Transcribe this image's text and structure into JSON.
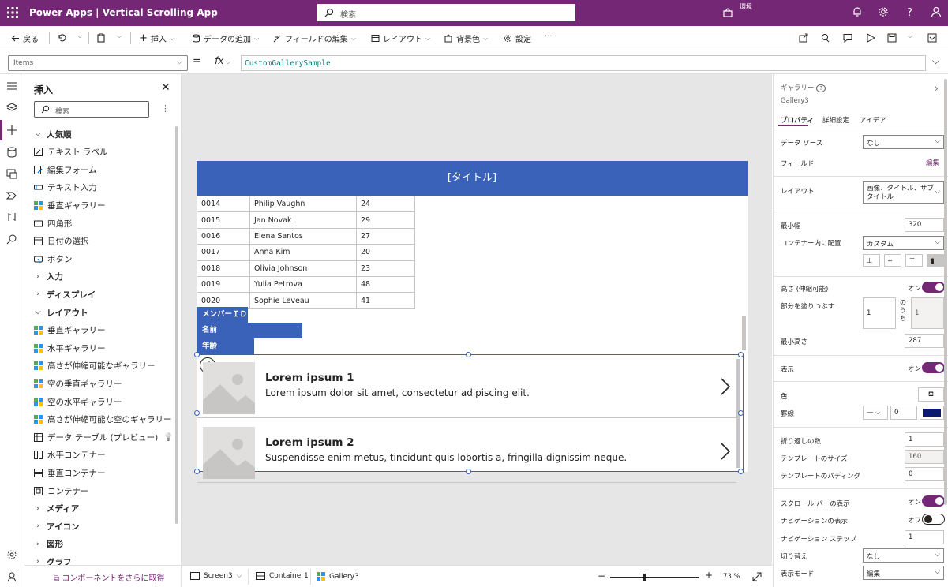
{
  "topbar": {
    "app_title": "Power Apps  |  Vertical Scrolling App",
    "search_placeholder": "検索",
    "env_label": "環境"
  },
  "commands": {
    "back": "戻る",
    "insert": "挿入",
    "add_data": "データの追加",
    "edit_fields": "フィールドの編集",
    "layout": "レイアウト",
    "background": "背景色",
    "settings": "設定",
    "more": "···"
  },
  "formula_bar": {
    "property": "Items",
    "equals": "=",
    "fx": "fx",
    "formula": "CustomGallerySample"
  },
  "insert_pane": {
    "title": "挿入",
    "search_placeholder": "検索",
    "items": [
      {
        "label": "人気順",
        "kind": "category",
        "icon": "chevron-down-icon"
      },
      {
        "label": "テキスト ラベル",
        "kind": "item",
        "icon": "text-label-icon"
      },
      {
        "label": "編集フォーム",
        "kind": "item",
        "icon": "edit-form-icon"
      },
      {
        "label": "テキスト入力",
        "kind": "item",
        "icon": "text-input-icon"
      },
      {
        "label": "垂直ギャラリー",
        "kind": "item",
        "icon": "gallery-icon"
      },
      {
        "label": "四角形",
        "kind": "item",
        "icon": "rectangle-icon"
      },
      {
        "label": "日付の選択",
        "kind": "item",
        "icon": "calendar-icon"
      },
      {
        "label": "ボタン",
        "kind": "item",
        "icon": "button-icon"
      },
      {
        "label": "入力",
        "kind": "category",
        "icon": "chevron-right-icon"
      },
      {
        "label": "ディスプレイ",
        "kind": "category",
        "icon": "chevron-right-icon"
      },
      {
        "label": "レイアウト",
        "kind": "category",
        "icon": "chevron-down-icon"
      },
      {
        "label": "垂直ギャラリー",
        "kind": "item",
        "icon": "gallery-icon"
      },
      {
        "label": "水平ギャラリー",
        "kind": "item",
        "icon": "gallery-icon"
      },
      {
        "label": "高さが伸縮可能なギャラリー",
        "kind": "item",
        "icon": "gallery-icon"
      },
      {
        "label": "空の垂直ギャラリー",
        "kind": "item",
        "icon": "gallery-icon"
      },
      {
        "label": "空の水平ギャラリー",
        "kind": "item",
        "icon": "gallery-icon"
      },
      {
        "label": "高さが伸縮可能な空のギャラリー",
        "kind": "item",
        "icon": "gallery-icon"
      },
      {
        "label": "データ テーブル (プレビュー)",
        "kind": "item",
        "icon": "table-icon"
      },
      {
        "label": "水平コンテナー",
        "kind": "item",
        "icon": "horizontal-container-icon"
      },
      {
        "label": "垂直コンテナー",
        "kind": "item",
        "icon": "vertical-container-icon"
      },
      {
        "label": "コンテナー",
        "kind": "item",
        "icon": "container-icon"
      },
      {
        "label": "メディア",
        "kind": "category",
        "icon": "chevron-right-icon"
      },
      {
        "label": "アイコン",
        "kind": "category",
        "icon": "chevron-right-icon"
      },
      {
        "label": "図形",
        "kind": "category",
        "icon": "chevron-right-icon"
      },
      {
        "label": "グラフ",
        "kind": "category",
        "icon": "chevron-right-icon"
      }
    ],
    "get_more": "コンポーネントをさらに取得"
  },
  "canvas": {
    "title": "[タイトル]",
    "rows": [
      [
        "0014",
        "Philip Vaughn",
        "24"
      ],
      [
        "0015",
        "Jan Novak",
        "29"
      ],
      [
        "0016",
        "Elena Santos",
        "27"
      ],
      [
        "0017",
        "Anna Kim",
        "20"
      ],
      [
        "0018",
        "Olivia Johnson",
        "23"
      ],
      [
        "0019",
        "Yulia Petrova",
        "48"
      ],
      [
        "0020",
        "Sophie Leveau",
        "41"
      ]
    ],
    "headers": [
      "メンバーＩＤ",
      "名前",
      "年齢"
    ],
    "gallery_items": [
      {
        "title": "Lorem ipsum 1",
        "subtitle": "Lorem ipsum dolor sit amet, consectetur adipiscing elit."
      },
      {
        "title": "Lorem ipsum 2",
        "subtitle": "Suspendisse enim metus, tincidunt quis lobortis a, fringilla dignissim neque."
      }
    ]
  },
  "statusbar": {
    "screen": "Screen3",
    "container": "Container1",
    "gallery": "Gallery3",
    "zoom": "73 %"
  },
  "right_pane": {
    "kind": "ギャラリー",
    "name": "Gallery3",
    "tabs": [
      "プロパティ",
      "詳細設定",
      "アイデア"
    ],
    "datasource_label": "データ ソース",
    "datasource_value": "なし",
    "fields_label": "フィールド",
    "fields_link": "編集",
    "layout_label": "レイアウト",
    "layout_value_line1": "画像、タイトル、サブ",
    "layout_value_line2": "タイトル",
    "min_width_label": "最小幅",
    "min_width_value": "320",
    "align_label": "コンテナー内に配置",
    "align_value": "カスタム",
    "flex_height_label": "高さ (伸縮可能)",
    "on_label": "オン",
    "off_label": "オフ",
    "fill_portions_label": "部分を塗りつぶす",
    "fill_value": "1",
    "of_label": "のうち",
    "of_value": "1",
    "min_height_label": "最小高さ",
    "min_height_value": "287",
    "visible_label": "表示",
    "color_label": "色",
    "border_label": "罫線",
    "border_width": "0",
    "border_color": "#0b1a6e",
    "wrap_count_label": "折り返しの数",
    "wrap_count_value": "1",
    "template_size_label": "テンプレートのサイズ",
    "template_size_value": "160",
    "template_padding_label": "テンプレートのパディング",
    "template_padding_value": "0",
    "scrollbar_label": "スクロール バーの表示",
    "navigation_label": "ナビゲーションの表示",
    "nav_step_label": "ナビゲーション ステップ",
    "nav_step_value": "1",
    "transition_label": "切り替え",
    "transition_value": "なし",
    "display_mode_label": "表示モード",
    "display_mode_value": "編集"
  },
  "colors": {
    "brand": "#742774",
    "title_bar": "#3b62b9"
  }
}
